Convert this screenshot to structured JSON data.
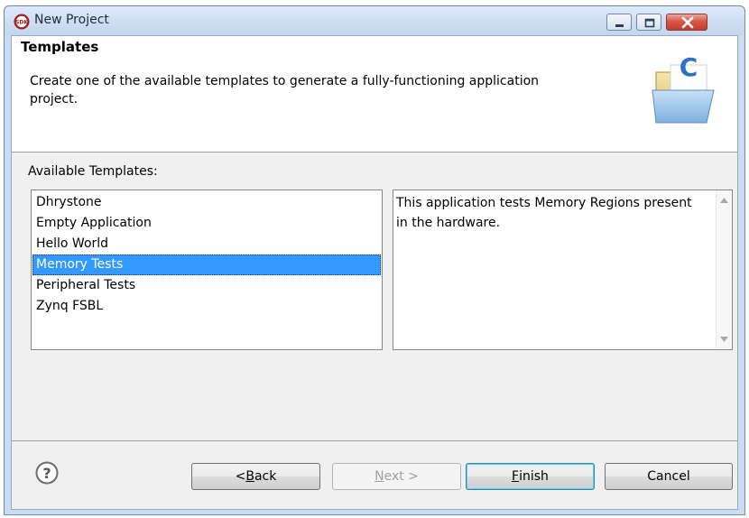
{
  "window": {
    "title": "New Project",
    "icon": "sdk-logo-icon",
    "controls": [
      "minimize-icon",
      "maximize-icon",
      "close-icon"
    ]
  },
  "banner": {
    "title": "Templates",
    "description": "Create one of the available templates to generate a fully-functioning application project.",
    "icon": "c-folder-icon"
  },
  "templates": {
    "label": "Available Templates:",
    "items": [
      {
        "label": "Dhrystone",
        "selected": false
      },
      {
        "label": "Empty Application",
        "selected": false
      },
      {
        "label": "Hello World",
        "selected": false
      },
      {
        "label": "Memory Tests",
        "selected": true
      },
      {
        "label": "Peripheral Tests",
        "selected": false
      },
      {
        "label": "Zynq FSBL",
        "selected": false
      }
    ],
    "description": "This application tests Memory Regions present in the hardware."
  },
  "buttons": {
    "back": {
      "prefix": "< ",
      "mnemonic": "B",
      "rest": "ack"
    },
    "next": {
      "mnemonic": "N",
      "rest": "ext >",
      "enabled": false
    },
    "finish": {
      "mnemonic": "F",
      "rest": "inish"
    },
    "cancel": "Cancel"
  },
  "colors": {
    "selection": "#3399ff",
    "title_bar": "#cfdff3",
    "close_button": "#c43b2a"
  }
}
